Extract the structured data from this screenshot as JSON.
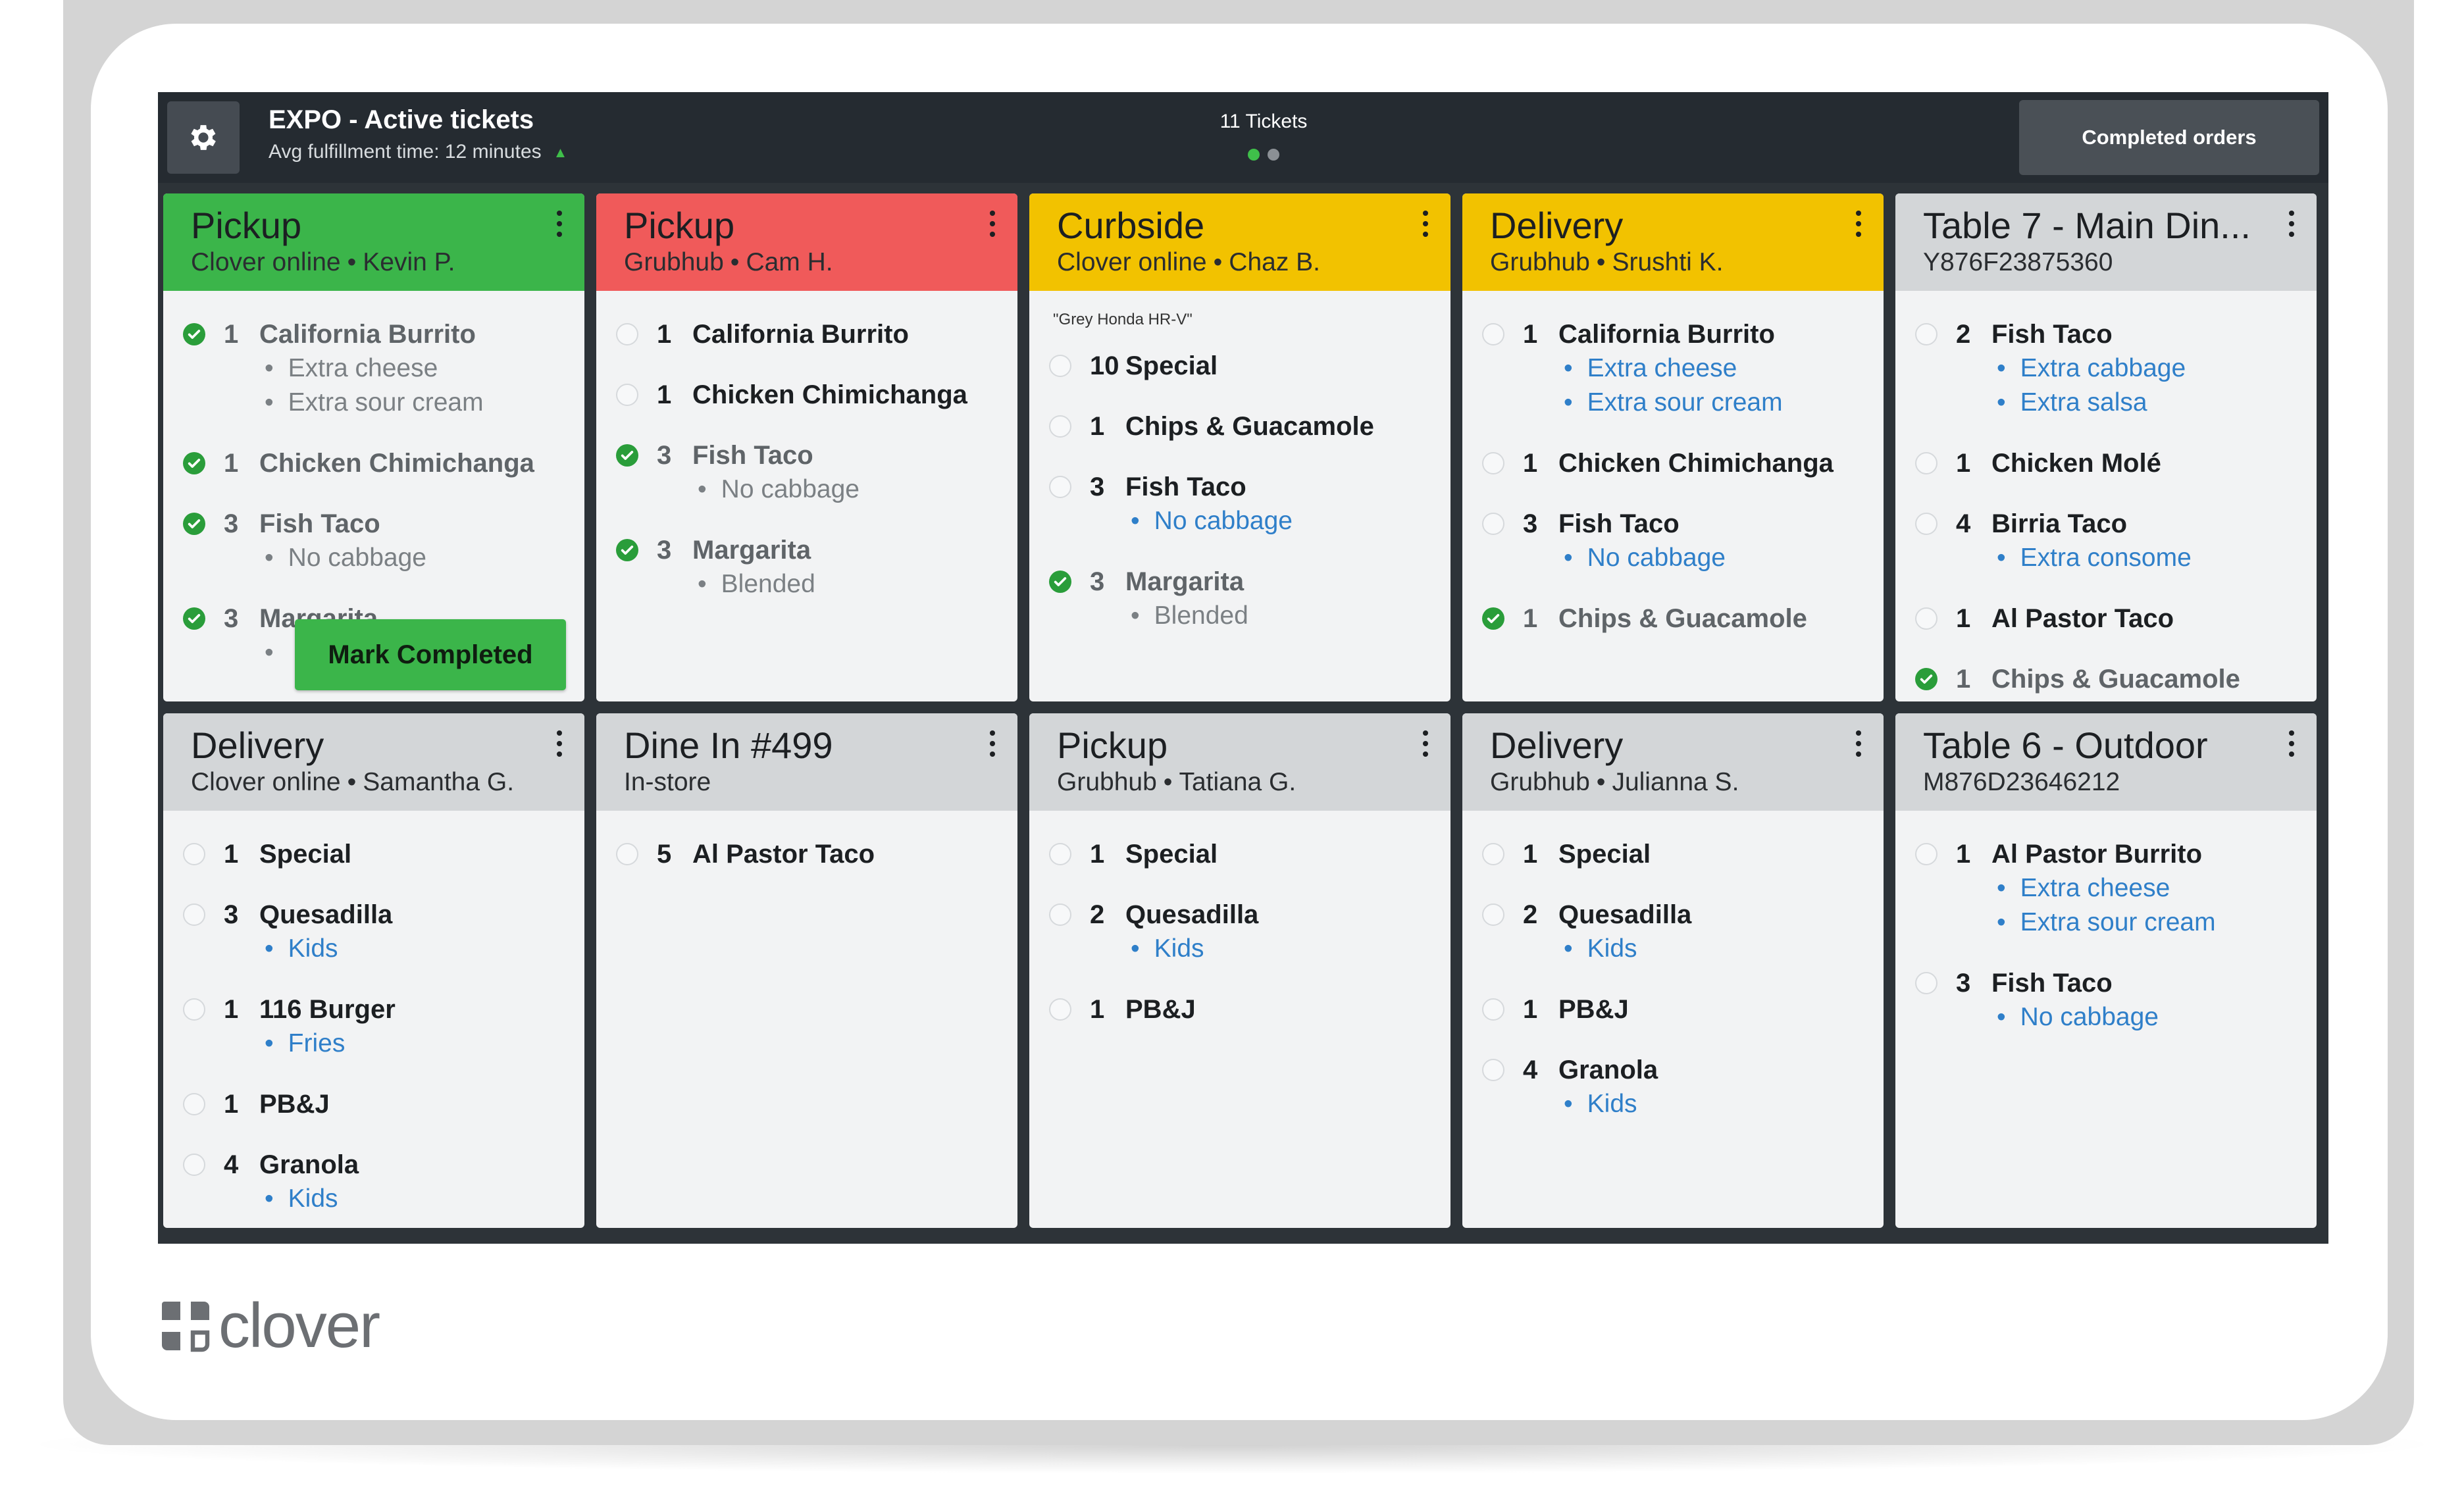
{
  "topbar": {
    "title": "EXPO - Active tickets",
    "subtitle": "Avg fulfillment time: 12 minutes",
    "ticket_count": "11 Tickets",
    "completed_orders_label": "Completed orders",
    "settings_icon": "gear-icon"
  },
  "mark_completed_label": "Mark Completed",
  "brand": {
    "name": "clover"
  },
  "colors": {
    "green_header": "#3bb54a",
    "red_header": "#f05a5a",
    "yellow_header": "#f2c200",
    "grey_header": "#d3d6d8",
    "modifier_blue": "#2f7fc9",
    "check_green": "#2a9d3a"
  },
  "tickets": [
    {
      "title": "Pickup",
      "source": "Clover online",
      "customer": "Kevin P.",
      "header_color": "#3bb54a",
      "items": [
        {
          "qty": "1",
          "name": "California Burrito",
          "done": true,
          "mods": [
            "Extra cheese",
            "Extra sour cream"
          ]
        },
        {
          "qty": "1",
          "name": "Chicken Chimichanga",
          "done": true,
          "mods": []
        },
        {
          "qty": "3",
          "name": "Fish Taco",
          "done": true,
          "mods": [
            "No cabbage"
          ]
        },
        {
          "qty": "3",
          "name": "Margarita",
          "done": true,
          "mods": [
            ""
          ]
        }
      ]
    },
    {
      "title": "Pickup",
      "source": "Grubhub",
      "customer": "Cam H.",
      "header_color": "#f05a5a",
      "items": [
        {
          "qty": "1",
          "name": "California Burrito",
          "done": false,
          "mods": []
        },
        {
          "qty": "1",
          "name": "Chicken Chimichanga",
          "done": false,
          "mods": []
        },
        {
          "qty": "3",
          "name": "Fish Taco",
          "done": true,
          "mods": [
            "No cabbage"
          ]
        },
        {
          "qty": "3",
          "name": "Margarita",
          "done": true,
          "mods": [
            "Blended"
          ]
        }
      ]
    },
    {
      "title": "Curbside",
      "source": "Clover online",
      "customer": "Chaz B.",
      "header_color": "#f2c200",
      "note": "\"Grey Honda HR-V\"",
      "items": [
        {
          "qty": "10",
          "name": "Special",
          "done": false,
          "mods": []
        },
        {
          "qty": "1",
          "name": "Chips & Guacamole",
          "done": false,
          "mods": []
        },
        {
          "qty": "3",
          "name": "Fish Taco",
          "done": false,
          "mods": [
            "No cabbage"
          ]
        },
        {
          "qty": "3",
          "name": "Margarita",
          "done": true,
          "mods": [
            "Blended"
          ]
        }
      ]
    },
    {
      "title": "Delivery",
      "source": "Grubhub",
      "customer": "Srushti K.",
      "header_color": "#f2c200",
      "items": [
        {
          "qty": "1",
          "name": "California Burrito",
          "done": false,
          "mods": [
            "Extra cheese",
            "Extra sour cream"
          ]
        },
        {
          "qty": "1",
          "name": "Chicken Chimichanga",
          "done": false,
          "mods": []
        },
        {
          "qty": "3",
          "name": "Fish Taco",
          "done": false,
          "mods": [
            "No cabbage"
          ]
        },
        {
          "qty": "1",
          "name": "Chips & Guacamole",
          "done": true,
          "mods": []
        }
      ]
    },
    {
      "title": "Table 7 - Main Din...",
      "source": "Y876F23875360",
      "customer": "",
      "header_color": "#d3d6d8",
      "items": [
        {
          "qty": "2",
          "name": "Fish Taco",
          "done": false,
          "mods": [
            "Extra cabbage",
            "Extra salsa"
          ]
        },
        {
          "qty": "1",
          "name": "Chicken Molé",
          "done": false,
          "mods": []
        },
        {
          "qty": "4",
          "name": "Birria Taco",
          "done": false,
          "mods": [
            "Extra consome"
          ]
        },
        {
          "qty": "1",
          "name": "Al Pastor Taco",
          "done": false,
          "mods": []
        },
        {
          "qty": "1",
          "name": "Chips & Guacamole",
          "done": true,
          "mods": []
        }
      ]
    },
    {
      "title": "Delivery",
      "source": "Clover online",
      "customer": "Samantha G.",
      "header_color": "#d3d6d8",
      "items": [
        {
          "qty": "1",
          "name": "Special",
          "done": false,
          "mods": []
        },
        {
          "qty": "3",
          "name": "Quesadilla",
          "done": false,
          "mods": [
            "Kids"
          ]
        },
        {
          "qty": "1",
          "name": "116 Burger",
          "done": false,
          "mods": [
            "Fries"
          ]
        },
        {
          "qty": "1",
          "name": "PB&J",
          "done": false,
          "mods": []
        },
        {
          "qty": "4",
          "name": "Granola",
          "done": false,
          "mods": [
            "Kids"
          ]
        }
      ]
    },
    {
      "title": "Dine In #499",
      "source": "In-store",
      "customer": "",
      "header_color": "#d3d6d8",
      "items": [
        {
          "qty": "5",
          "name": "Al Pastor Taco",
          "done": false,
          "mods": []
        }
      ]
    },
    {
      "title": "Pickup",
      "source": "Grubhub",
      "customer": "Tatiana G.",
      "header_color": "#d3d6d8",
      "items": [
        {
          "qty": "1",
          "name": "Special",
          "done": false,
          "mods": []
        },
        {
          "qty": "2",
          "name": "Quesadilla",
          "done": false,
          "mods": [
            "Kids"
          ]
        },
        {
          "qty": "1",
          "name": "PB&J",
          "done": false,
          "mods": []
        }
      ]
    },
    {
      "title": "Delivery",
      "source": "Grubhub",
      "customer": "Julianna S.",
      "header_color": "#d3d6d8",
      "items": [
        {
          "qty": "1",
          "name": "Special",
          "done": false,
          "mods": []
        },
        {
          "qty": "2",
          "name": "Quesadilla",
          "done": false,
          "mods": [
            "Kids"
          ]
        },
        {
          "qty": "1",
          "name": "PB&J",
          "done": false,
          "mods": []
        },
        {
          "qty": "4",
          "name": "Granola",
          "done": false,
          "mods": [
            "Kids"
          ]
        }
      ]
    },
    {
      "title": "Table 6 - Outdoor",
      "source": "M876D23646212",
      "customer": "",
      "header_color": "#d3d6d8",
      "items": [
        {
          "qty": "1",
          "name": "Al Pastor Burrito",
          "done": false,
          "mods": [
            "Extra cheese",
            "Extra sour cream"
          ]
        },
        {
          "qty": "3",
          "name": "Fish Taco",
          "done": false,
          "mods": [
            "No cabbage"
          ]
        }
      ]
    }
  ]
}
